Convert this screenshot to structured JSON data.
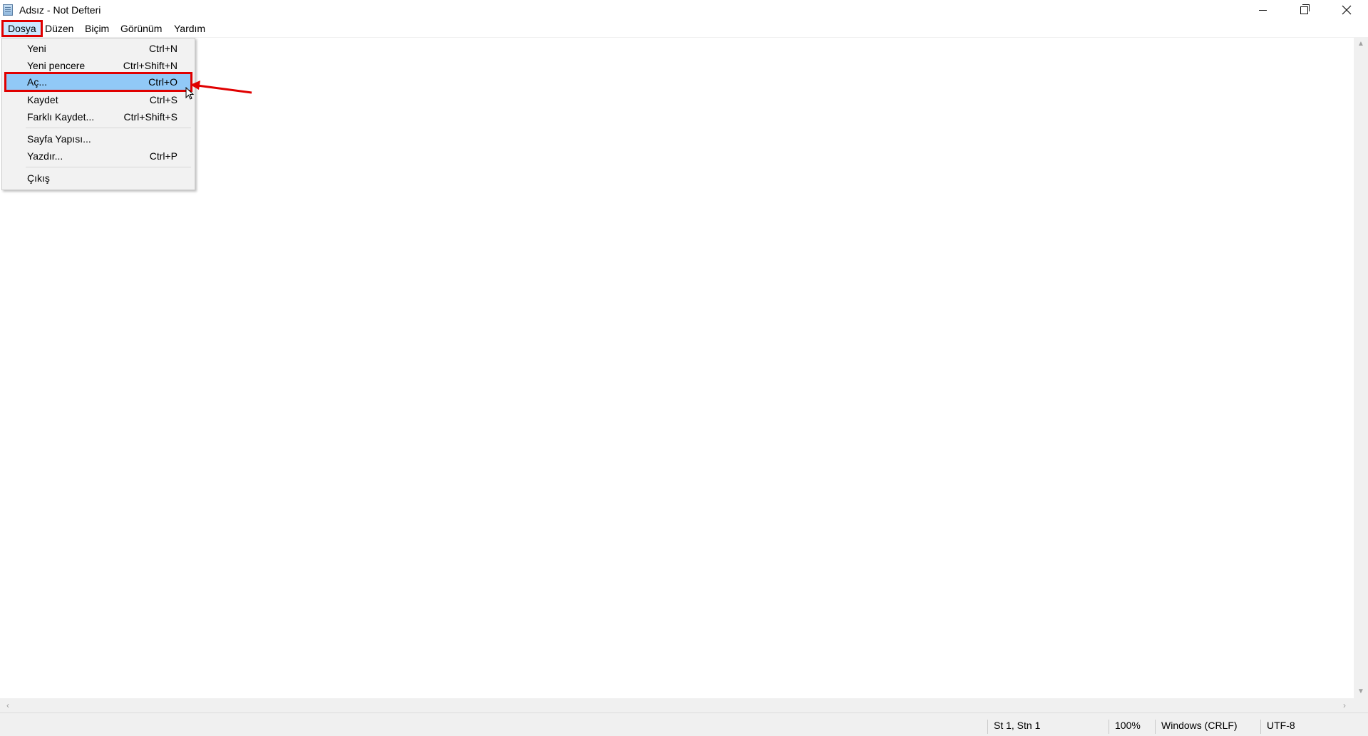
{
  "window": {
    "title": "Adsız - Not Defteri"
  },
  "menubar": {
    "items": [
      {
        "label": "Dosya"
      },
      {
        "label": "Düzen"
      },
      {
        "label": "Biçim"
      },
      {
        "label": "Görünüm"
      },
      {
        "label": "Yardım"
      }
    ]
  },
  "file_menu": {
    "items": [
      {
        "label": "Yeni",
        "shortcut": "Ctrl+N"
      },
      {
        "label": "Yeni pencere",
        "shortcut": "Ctrl+Shift+N"
      },
      {
        "label": "Aç...",
        "shortcut": "Ctrl+O"
      },
      {
        "label": "Kaydet",
        "shortcut": "Ctrl+S"
      },
      {
        "label": "Farklı Kaydet...",
        "shortcut": "Ctrl+Shift+S"
      },
      {
        "label": "Sayfa Yapısı...",
        "shortcut": ""
      },
      {
        "label": "Yazdır...",
        "shortcut": "Ctrl+P"
      },
      {
        "label": "Çıkış",
        "shortcut": ""
      }
    ]
  },
  "statusbar": {
    "position": "St 1, Stn 1",
    "zoom": "100%",
    "line_ending": "Windows (CRLF)",
    "encoding": "UTF-8"
  },
  "colors": {
    "highlight": "#91c9f7",
    "annotation_red": "#e00000"
  },
  "icons": {
    "app": "notepad-icon",
    "minimize": "minimize-icon",
    "maximize": "restore-icon",
    "close": "close-icon",
    "cursor": "mouse-pointer-icon",
    "annotation": "red-arrow-icon"
  }
}
